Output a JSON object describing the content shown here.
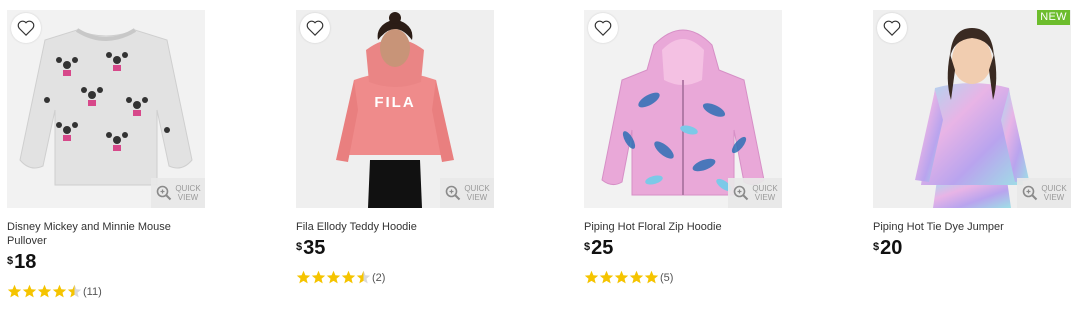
{
  "products": [
    {
      "title": "Disney Mickey and Minnie Mouse Pullover",
      "currency": "$",
      "price": "18",
      "rating": 4.5,
      "reviews": "(11)",
      "badge": null
    },
    {
      "title": "Fila Ellody Teddy Hoodie",
      "currency": "$",
      "price": "35",
      "rating": 4.5,
      "reviews": "(2)",
      "badge": null,
      "print_text": "FILA"
    },
    {
      "title": "Piping Hot Floral Zip Hoodie",
      "currency": "$",
      "price": "25",
      "rating": 5,
      "reviews": "(5)",
      "badge": null
    },
    {
      "title": "Piping Hot Tie Dye Jumper",
      "currency": "$",
      "price": "20",
      "rating": null,
      "reviews": null,
      "badge": "NEW"
    }
  ],
  "quick_view": {
    "line1": "QUICK",
    "line2": "VIEW"
  },
  "colors": {
    "star": "#f5c400",
    "star_empty": "#d9d9d9",
    "badge_new": "#6dbd2d",
    "fila_pink": "#ef8b8b",
    "floral_pink": "#e9a8d8",
    "tiedye": "#c9b7ee"
  }
}
